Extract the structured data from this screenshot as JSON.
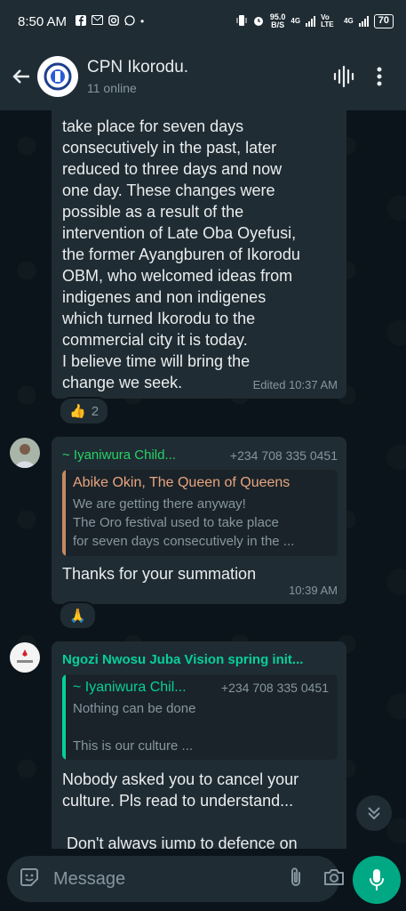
{
  "status": {
    "time": "8:50 AM",
    "speed_value": "95.0",
    "speed_unit": "B/S",
    "net1": "4G",
    "net2": "Vo LTE",
    "net3": "4G",
    "battery": "70"
  },
  "header": {
    "name": "CPN Ikorodu.",
    "subtitle": "11 online"
  },
  "messages": {
    "m1": {
      "text": "take place for seven days\nconsecutively in the past, later\nreduced to three days and now\none day. These changes were\npossible as a result of the\nintervention of Late Oba Oyefusi,\nthe former Ayangburen of Ikorodu\nOBM, who welcomed ideas from\nindigenes and non indigenes\nwhich turned Ikorodu to the\ncommercial city it is today.\nI believe time will bring the\nchange we seek.",
      "meta": "Edited 10:37 AM",
      "reaction_emoji": "👍",
      "reaction_count": "2"
    },
    "m2": {
      "sender": "~ Iyaniwura Child...",
      "phone": "+234 708 335 0451",
      "quote_name": "Abike Okin, The Queen of Queens",
      "quote_text": "We are getting there anyway!\nThe Oro festival used to take place\nfor seven days consecutively in the ...",
      "text": "Thanks for your summation",
      "meta": "10:39 AM",
      "reaction_emoji": "🙏"
    },
    "m3": {
      "sender": "Ngozi Nwosu Juba Vision spring init...",
      "quote_name": "~ Iyaniwura Chil...",
      "quote_phone": "+234 708 335 0451",
      "quote_text": "Nothing can be done\n\nThis is our culture ...",
      "text": "Nobody asked you to cancel your\nculture. Pls read to understand...\n\n Don't always jump to defence on"
    }
  },
  "composer": {
    "placeholder": "Message"
  },
  "colors": {
    "accent": "#00a884",
    "sender_green": "#25d366",
    "bubble": "#202c33",
    "background": "#0b141a"
  }
}
